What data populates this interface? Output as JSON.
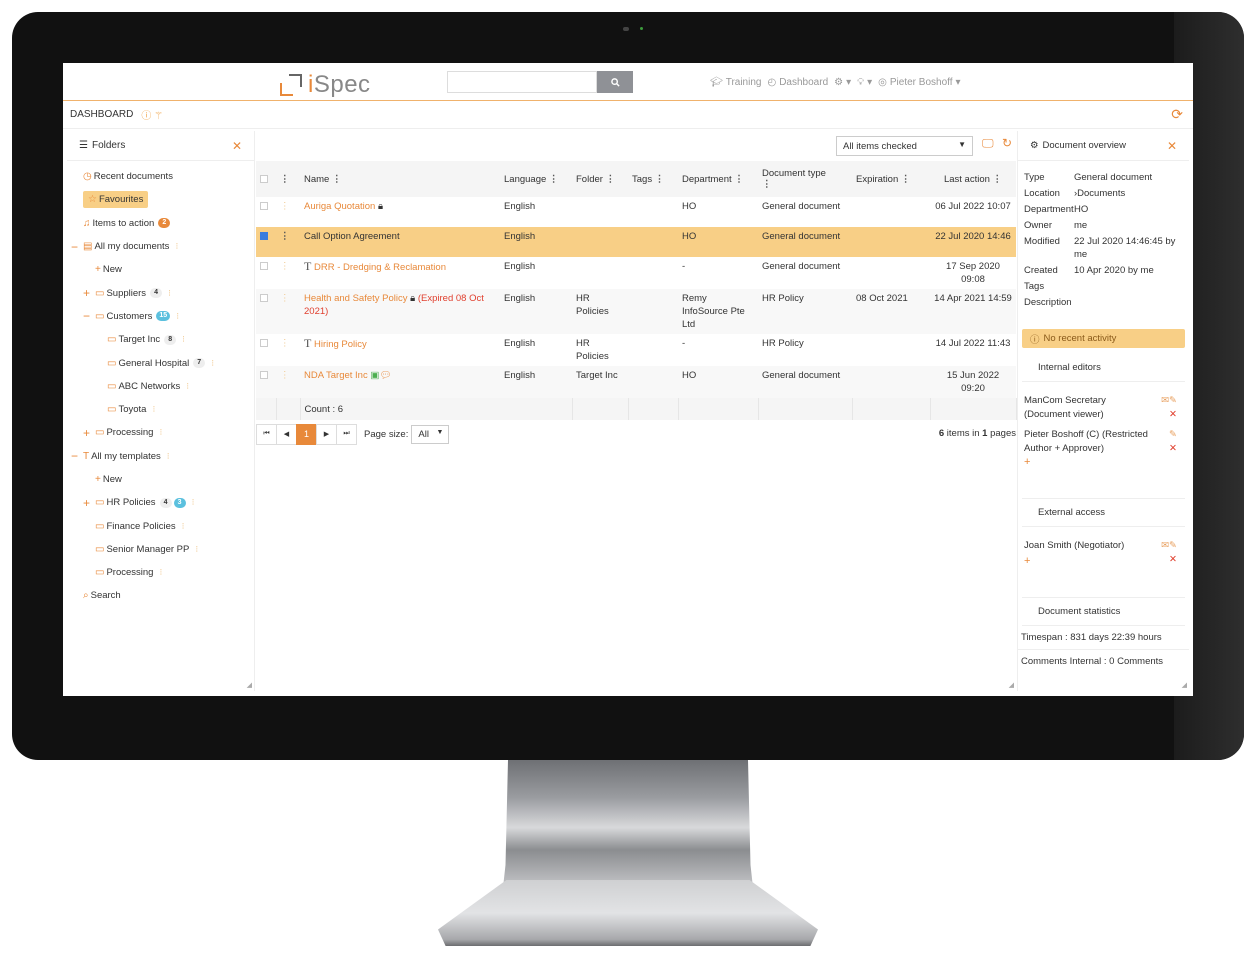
{
  "app": {
    "logo_text_prefix": "i",
    "logo_text_suffix": "Spec",
    "search_placeholder": "",
    "nav": {
      "training": "Training",
      "dashboard": "Dashboard",
      "user": "Pieter Boshoff"
    }
  },
  "dashboard": {
    "title": "DASHBOARD"
  },
  "folders": {
    "title": "Folders",
    "items": [
      {
        "label": "Recent documents",
        "icon": "clock-icon"
      },
      {
        "label": "Favourites",
        "icon": "star-icon",
        "selected": true
      },
      {
        "label": "Items to action",
        "icon": "bell-icon",
        "badge": "2"
      },
      {
        "label": "All my documents",
        "icon": "document-icon",
        "toggle": "−"
      },
      {
        "label": "New",
        "icon": "plus-icon"
      },
      {
        "label": "Suppliers",
        "icon": "folder-icon",
        "toggle": "+",
        "badge": "4"
      },
      {
        "label": "Customers",
        "icon": "folder-icon",
        "toggle": "−",
        "badge": "15"
      },
      {
        "label": "Target Inc",
        "icon": "folder-icon",
        "badge": "8"
      },
      {
        "label": "General Hospital",
        "icon": "folder-icon",
        "badge": "7"
      },
      {
        "label": "ABC Networks",
        "icon": "folder-icon"
      },
      {
        "label": "Toyota",
        "icon": "folder-icon"
      },
      {
        "label": "Processing",
        "icon": "folder-icon",
        "toggle": "+"
      },
      {
        "label": "All my templates",
        "icon": "template-icon",
        "toggle": "−"
      },
      {
        "label": "New",
        "icon": "plus-icon"
      },
      {
        "label": "HR Policies",
        "icon": "folder-icon",
        "toggle": "+",
        "badge": "4",
        "badge2": "3"
      },
      {
        "label": "Finance Policies",
        "icon": "folder-icon"
      },
      {
        "label": "Senior Manager PP",
        "icon": "folder-icon"
      },
      {
        "label": "Processing",
        "icon": "folder-icon"
      },
      {
        "label": "Search",
        "icon": "search-icon"
      }
    ]
  },
  "table": {
    "filter_select": "All items checked",
    "columns": [
      "Name",
      "Language",
      "Folder",
      "Tags",
      "Department",
      "Document type",
      "Expiration",
      "Last action"
    ],
    "rows": [
      {
        "name": "Auriga Quotation",
        "lock": true,
        "language": "English",
        "folder": "",
        "tags": "",
        "department": "HO",
        "doctype": "General document",
        "expiration": "",
        "last_action": "06 Jul 2022 10:07"
      },
      {
        "name": "Call Option Agreement",
        "selected": true,
        "language": "English",
        "folder": "",
        "tags": "",
        "department": "HO",
        "doctype": "General document",
        "expiration": "",
        "last_action": "22 Jul 2020 14:46"
      },
      {
        "name": "DRR - Dredging & Reclamation",
        "template": true,
        "language": "English",
        "folder": "",
        "tags": "",
        "department": "-",
        "doctype": "General document",
        "expiration": "",
        "last_action": "17 Sep 2020 09:08"
      },
      {
        "name": "Health and Safety Policy",
        "lock": true,
        "expired_note": "(Expired 08 Oct 2021)",
        "language": "English",
        "folder": "HR Policies",
        "tags": "",
        "department": "Remy InfoSource Pte Ltd",
        "doctype": "HR Policy",
        "expiration": "08 Oct 2021",
        "last_action": "14 Apr 2021 14:59"
      },
      {
        "name": "Hiring Policy",
        "template": true,
        "language": "English",
        "folder": "HR Policies",
        "tags": "",
        "department": "-",
        "doctype": "HR Policy",
        "expiration": "",
        "last_action": "14 Jul 2022 11:43"
      },
      {
        "name": "NDA Target Inc",
        "attachments": true,
        "language": "English",
        "folder": "Target Inc",
        "tags": "",
        "department": "HO",
        "doctype": "General document",
        "expiration": "",
        "last_action": "15 Jun 2022 09:20"
      }
    ],
    "count_label": "Count : 6",
    "pager": {
      "current_page": "1",
      "page_size_label": "Page size:",
      "page_size": "All",
      "items_count": "6",
      "pages_count": "1",
      "items_text": "items in",
      "pages_text": "pages"
    }
  },
  "overview": {
    "title": "Document overview",
    "fields": [
      {
        "key": "Type",
        "value": "General document"
      },
      {
        "key": "Location",
        "value": "›Documents"
      },
      {
        "key": "Department",
        "value": "HO"
      },
      {
        "key": "Owner",
        "value": "me"
      },
      {
        "key": "Modified",
        "value": "22 Jul 2020 14:46:45 by me"
      },
      {
        "key": "Created",
        "value": "10 Apr 2020 by me"
      },
      {
        "key": "Tags",
        "value": ""
      },
      {
        "key": "Description",
        "value": ""
      }
    ],
    "activity": "No recent activity",
    "internal_title": "Internal editors",
    "internal_editors": [
      {
        "name": "ManCom Secretary (Document viewer)",
        "email": true
      },
      {
        "name": "Pieter Boshoff (C) (Restricted Author + Approver)",
        "email": false
      }
    ],
    "external_title": "External access",
    "external": [
      {
        "name": "Joan Smith (Negotiator)",
        "email": true
      }
    ],
    "stats_title": "Document statistics",
    "timespan": "Timespan : 831 days 22:39 hours",
    "comments": "Comments Internal : 0 Comments"
  },
  "colors": {
    "accent": "#e8893a",
    "selected_row": "#f8cf86",
    "expired": "#e0402f",
    "badge_blue": "#5bc0de"
  }
}
